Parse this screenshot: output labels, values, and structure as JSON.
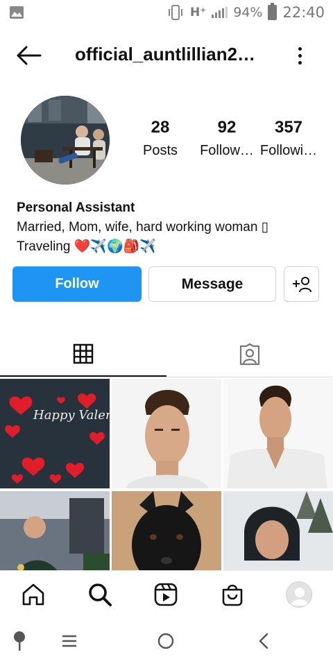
{
  "status_bar": {
    "network": "H⁺",
    "battery": "94%",
    "time": "22:40",
    "icons": [
      "image-icon",
      "vibrate-icon",
      "signal-icon",
      "battery-icon"
    ]
  },
  "header": {
    "username": "official_auntlillian2…",
    "back_icon": "arrow-left-icon",
    "more_icon": "more-vertical-icon"
  },
  "profile": {
    "stats": [
      {
        "value": "28",
        "label": "Posts"
      },
      {
        "value": "92",
        "label": "Follow…"
      },
      {
        "value": "357",
        "label": "Followi…"
      }
    ],
    "name": "Personal Assistant",
    "bio_line1": "Married, Mom, wife, hard working woman ▯",
    "bio_line2_text": "Traveling",
    "bio_line2_emoji": "❤️✈️🌍🎒✈️"
  },
  "actions": {
    "follow": "Follow",
    "message": "Message",
    "add_user_icon": "add-user-icon"
  },
  "tabs": [
    {
      "name": "grid",
      "icon": "grid-icon",
      "active": true
    },
    {
      "name": "tagged",
      "icon": "tagged-user-icon",
      "active": false
    }
  ],
  "posts": [
    {
      "id": 1,
      "caption": "Happy Valentine's Day"
    },
    {
      "id": 2
    },
    {
      "id": 3
    },
    {
      "id": 4
    },
    {
      "id": 5
    },
    {
      "id": 6
    }
  ],
  "bottom_nav": [
    "home-icon",
    "search-icon",
    "reels-icon",
    "shop-icon",
    "profile-icon"
  ],
  "system_nav": [
    "assistant-icon",
    "recents-icon",
    "home-circle-icon",
    "back-chevron-icon"
  ],
  "colors": {
    "accent": "#1e95f3",
    "heart": "#e0243a"
  }
}
